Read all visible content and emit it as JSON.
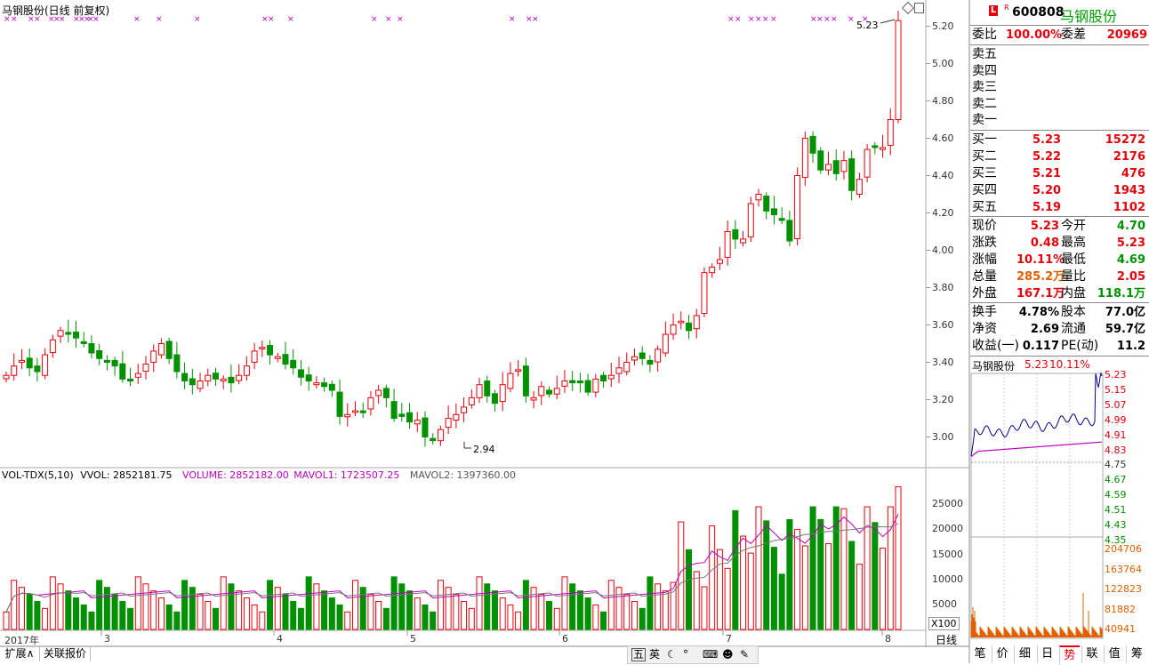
{
  "main": {
    "title": "马钢股份(日线 前复权)",
    "price_ticks": [
      "5.20",
      "5.00",
      "4.80",
      "4.60",
      "4.40",
      "4.20",
      "4.00",
      "3.80",
      "3.60",
      "3.40",
      "3.20",
      "3.00"
    ],
    "high_label": "5.23",
    "low_label": "2.94"
  },
  "volume": {
    "header": {
      "indicator": "VOL-TDX(5,10)",
      "vvol": "VVOL: 2852181.75",
      "volume": "VOLUME: 2852182.00",
      "mavol1": "MAVOL1: 1723507.25",
      "mavol2": "MAVOL2: 1397360.00"
    },
    "ticks": [
      "25000",
      "20000",
      "15000",
      "10000",
      "5000"
    ],
    "unit": "X100"
  },
  "date_axis": {
    "labels": [
      "2017年",
      "3",
      "4",
      "5",
      "6",
      "7",
      "8"
    ],
    "period": "日线"
  },
  "bottom_tabs": [
    "扩展∧",
    "关联报价"
  ],
  "taskbar": {
    "ime": [
      "五",
      "英"
    ]
  },
  "side_tabs": [
    "笔",
    "价",
    "细",
    "日",
    "势",
    "联",
    "值",
    "筹"
  ],
  "quote": {
    "code": "600808",
    "name": "马钢股份",
    "weibi_label": "委比",
    "weibi_value": "100.00%",
    "weicha_label": "委差",
    "weicha_value": "20969",
    "sells": [
      "卖五",
      "卖四",
      "卖三",
      "卖二",
      "卖一"
    ],
    "buys": [
      {
        "label": "买一",
        "price": "5.23",
        "vol": "15272"
      },
      {
        "label": "买二",
        "price": "5.22",
        "vol": "2176"
      },
      {
        "label": "买三",
        "price": "5.21",
        "vol": "476"
      },
      {
        "label": "买四",
        "price": "5.20",
        "vol": "1943"
      },
      {
        "label": "买五",
        "price": "5.19",
        "vol": "1102"
      }
    ],
    "stats": [
      {
        "l1": "现价",
        "v1": "5.23",
        "l2": "今开",
        "v2": "4.70"
      },
      {
        "l1": "涨跌",
        "v1": "0.48",
        "l2": "最高",
        "v2": "5.23"
      },
      {
        "l1": "涨幅",
        "v1": "10.11%",
        "l2": "最低",
        "v2": "4.69"
      },
      {
        "l1": "总量",
        "v1": "285.2万",
        "l2": "量比",
        "v2": "2.05"
      },
      {
        "l1": "外盘",
        "v1": "167.1万",
        "l2": "内盘",
        "v2": "118.1万"
      }
    ],
    "fund": [
      {
        "l1": "换手",
        "v1": "4.78%",
        "l2": "股本",
        "v2": "77.0亿"
      },
      {
        "l1": "净资",
        "v1": "2.69",
        "l2": "流通",
        "v2": "59.7亿"
      },
      {
        "l1": "收益(一)",
        "v1": "0.117",
        "l2": "PE(动)",
        "v2": "11.2"
      }
    ]
  },
  "intraday": {
    "name": "马钢股份",
    "price": "5.23",
    "pct": "10.11%",
    "price_ticks": [
      "5.23",
      "5.15",
      "5.07",
      "4.99",
      "4.91",
      "4.83",
      "4.75",
      "4.67",
      "4.59",
      "4.51",
      "4.43",
      "4.35"
    ],
    "vol_ticks": [
      "204706",
      "163764",
      "122823",
      "81882",
      "40941"
    ]
  }
}
